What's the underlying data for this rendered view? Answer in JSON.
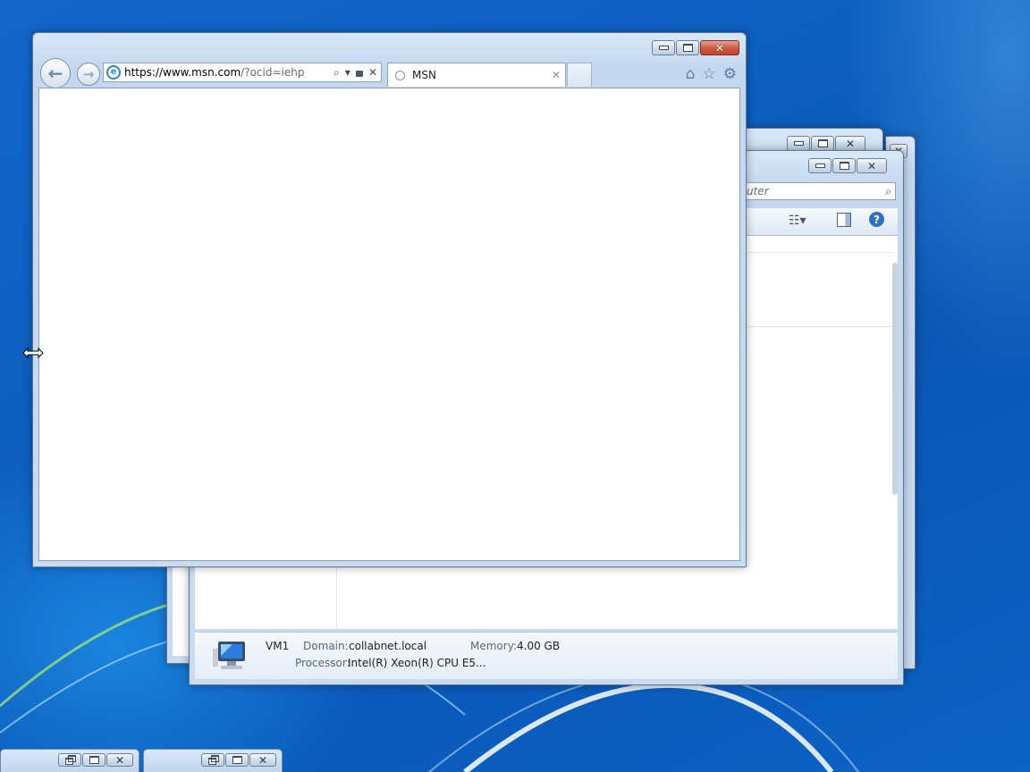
{
  "browser": {
    "address_host": "https://www.msn.com",
    "address_path": "/?ocid=iehp",
    "tab_title": "MSN",
    "icons": [
      "back-arrow-icon",
      "forward-arrow-icon",
      "ie-logo-icon",
      "search-icon",
      "dropdown-arrow-icon",
      "lock-icon",
      "stop-icon",
      "home-icon",
      "favorites-star-icon",
      "tools-gear-icon"
    ]
  },
  "explorer": {
    "search_placeholder": "uter",
    "details": {
      "computer_name": "VM1",
      "domain_label": "Domain:",
      "domain_value": "collabnet.local",
      "memory_label": "Memory:",
      "memory_value": "4.00 GB",
      "processor_label": "Processor:",
      "processor_value": "Intel(R) Xeon(R) CPU E5..."
    }
  },
  "theme": {
    "desktop": "#0d5fc0",
    "close_red": "#cf5b45",
    "frame": "#c3d7ef"
  }
}
